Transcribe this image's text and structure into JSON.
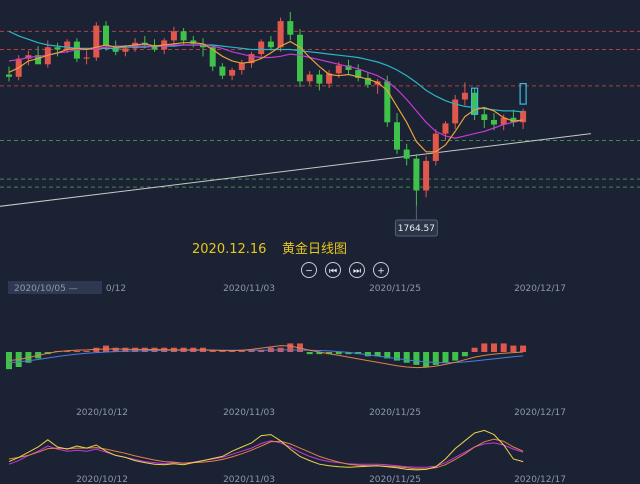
{
  "caption": {
    "date": "2020.12.16",
    "title": "黄金日线图"
  },
  "price_flag": "1764.57",
  "date_box": "2020/10/05 —",
  "colors": {
    "up": "#e0574e",
    "down": "#3ec24a",
    "ma_fast": "#e8a03a",
    "ma_mid": "#c43bd6",
    "ma_slow": "#2bb5c4",
    "macd_line": "#e0824a",
    "signal_line": "#4a7fe0",
    "kdj_k": "#e8d44a",
    "kdj_d": "#e0824a",
    "kdj_j": "#c43bd6",
    "trend": "#c8c8c8",
    "level_red": "#b04040",
    "level_green": "#3e8a4a",
    "outline": "#38bde8"
  },
  "controls": [
    {
      "name": "zoom-out-button",
      "icon": "minus-icon",
      "glyph": "−"
    },
    {
      "name": "step-back-button",
      "icon": "skip-back-icon",
      "glyph": "⏮"
    },
    {
      "name": "step-forward-button",
      "icon": "skip-forward-icon",
      "glyph": "⏭"
    },
    {
      "name": "zoom-in-button",
      "icon": "plus-icon",
      "glyph": "+"
    }
  ],
  "chart_data": [
    {
      "type": "candlestick",
      "x_ticks": [
        "0/12",
        "2020/11/03",
        "2020/11/25",
        "2020/12/17"
      ],
      "ylim": [
        1745,
        1935
      ],
      "levels": [
        {
          "y": 1918,
          "color": "level_red"
        },
        {
          "y": 1902,
          "color": "level_red"
        },
        {
          "y": 1870,
          "color": "level_red"
        },
        {
          "y": 1822,
          "color": "level_green"
        },
        {
          "y": 1788,
          "color": "level_green"
        },
        {
          "y": 1781,
          "color": "level_green"
        }
      ],
      "trendline": [
        [
          -1,
          1764
        ],
        [
          60,
          1828
        ]
      ],
      "low_marker": {
        "index": 42,
        "value": 1764.57
      },
      "candles": [
        [
          1880,
          1887,
          1874,
          1878
        ],
        [
          1878,
          1897,
          1875,
          1894
        ],
        [
          1894,
          1901,
          1888,
          1897
        ],
        [
          1897,
          1905,
          1891,
          1889
        ],
        [
          1889,
          1910,
          1886,
          1904
        ],
        [
          1904,
          1908,
          1896,
          1902
        ],
        [
          1902,
          1911,
          1899,
          1909
        ],
        [
          1909,
          1912,
          1891,
          1894
        ],
        [
          1894,
          1901,
          1889,
          1895
        ],
        [
          1895,
          1926,
          1892,
          1923
        ],
        [
          1923,
          1927,
          1901,
          1905
        ],
        [
          1905,
          1910,
          1897,
          1900
        ],
        [
          1900,
          1906,
          1896,
          1903
        ],
        [
          1903,
          1912,
          1900,
          1908
        ],
        [
          1908,
          1914,
          1903,
          1906
        ],
        [
          1906,
          1911,
          1900,
          1902
        ],
        [
          1902,
          1912,
          1898,
          1910
        ],
        [
          1910,
          1922,
          1907,
          1918
        ],
        [
          1918,
          1921,
          1906,
          1910
        ],
        [
          1910,
          1914,
          1904,
          1907
        ],
        [
          1907,
          1912,
          1896,
          1904
        ],
        [
          1904,
          1906,
          1883,
          1887
        ],
        [
          1887,
          1890,
          1876,
          1879
        ],
        [
          1879,
          1886,
          1875,
          1884
        ],
        [
          1884,
          1893,
          1880,
          1890
        ],
        [
          1890,
          1900,
          1886,
          1898
        ],
        [
          1898,
          1911,
          1894,
          1909
        ],
        [
          1909,
          1914,
          1901,
          1904
        ],
        [
          1904,
          1930,
          1900,
          1927
        ],
        [
          1927,
          1935,
          1910,
          1915
        ],
        [
          1915,
          1920,
          1869,
          1874
        ],
        [
          1874,
          1883,
          1871,
          1880
        ],
        [
          1880,
          1884,
          1866,
          1872
        ],
        [
          1872,
          1884,
          1868,
          1881
        ],
        [
          1881,
          1891,
          1877,
          1888
        ],
        [
          1888,
          1893,
          1880,
          1884
        ],
        [
          1884,
          1889,
          1874,
          1877
        ],
        [
          1877,
          1882,
          1868,
          1871
        ],
        [
          1871,
          1876,
          1863,
          1874
        ],
        [
          1874,
          1879,
          1834,
          1838
        ],
        [
          1838,
          1846,
          1810,
          1814
        ],
        [
          1814,
          1819,
          1800,
          1806
        ],
        [
          1806,
          1810,
          1764,
          1778
        ],
        [
          1778,
          1808,
          1772,
          1804
        ],
        [
          1804,
          1832,
          1800,
          1828
        ],
        [
          1828,
          1839,
          1822,
          1837
        ],
        [
          1837,
          1862,
          1832,
          1858
        ],
        [
          1858,
          1873,
          1853,
          1864
        ],
        [
          1864,
          1868,
          1840,
          1845
        ],
        [
          1845,
          1850,
          1833,
          1840
        ],
        [
          1840,
          1846,
          1831,
          1836
        ],
        [
          1836,
          1845,
          1831,
          1842
        ],
        [
          1842,
          1849,
          1834,
          1838
        ],
        [
          1838,
          1850,
          1832,
          1848
        ]
      ],
      "outline_candles": [
        {
          "index": 48,
          "values": [
            1868,
            1868,
            1845,
            1845
          ]
        },
        {
          "index": 53,
          "values": [
            1854,
            1872,
            1854,
            1872
          ]
        }
      ],
      "ma": {
        "fast": [
          1882,
          1886,
          1892,
          1894,
          1897,
          1899,
          1902,
          1903,
          1902,
          1904,
          1906,
          1904,
          1905,
          1906,
          1907,
          1905,
          1906,
          1907,
          1908,
          1908,
          1907,
          1902,
          1896,
          1892,
          1890,
          1891,
          1894,
          1899,
          1905,
          1909,
          1904,
          1895,
          1887,
          1880,
          1879,
          1880,
          1878,
          1876,
          1873,
          1866,
          1852,
          1838,
          1821,
          1812,
          1812,
          1818,
          1830,
          1843,
          1849,
          1851,
          1848,
          1842,
          1839,
          1840
        ],
        "mid": [
          1892,
          1893,
          1895,
          1896,
          1897,
          1899,
          1900,
          1902,
          1902,
          1903,
          1904,
          1905,
          1905,
          1905,
          1905,
          1905,
          1905,
          1906,
          1906,
          1906,
          1906,
          1905,
          1903,
          1900,
          1898,
          1896,
          1895,
          1895,
          1896,
          1898,
          1897,
          1895,
          1893,
          1891,
          1889,
          1887,
          1885,
          1882,
          1879,
          1874,
          1867,
          1858,
          1848,
          1838,
          1830,
          1826,
          1824,
          1826,
          1828,
          1830,
          1833,
          1836,
          1838,
          1840
        ],
        "slow": [
          1918,
          1914,
          1911,
          1908,
          1906,
          1905,
          1904,
          1903,
          1903,
          1903,
          1903,
          1903,
          1904,
          1904,
          1904,
          1905,
          1905,
          1905,
          1906,
          1906,
          1906,
          1906,
          1905,
          1904,
          1903,
          1902,
          1902,
          1902,
          1902,
          1902,
          1901,
          1900,
          1899,
          1898,
          1897,
          1896,
          1895,
          1893,
          1891,
          1888,
          1884,
          1879,
          1873,
          1866,
          1861,
          1857,
          1854,
          1852,
          1851,
          1850,
          1849,
          1848,
          1848,
          1847
        ]
      }
    },
    {
      "type": "macd",
      "x_ticks": [
        "2020/10/12",
        "2020/11/03",
        "2020/11/25",
        "2020/12/17"
      ],
      "ylim": [
        -14,
        14
      ],
      "histogram": [
        -8,
        -7,
        -5,
        -3,
        -1,
        0.5,
        0.5,
        0.5,
        0.5,
        2,
        3,
        2,
        2,
        2,
        2,
        2,
        2,
        2,
        2,
        2,
        2,
        1,
        1,
        0.5,
        1,
        1,
        1,
        2,
        2,
        4,
        4,
        -1,
        -1,
        -1,
        -1,
        -1,
        -1,
        -2,
        -2,
        -3,
        -4,
        -5,
        -6,
        -7,
        -6,
        -5,
        -4,
        -2,
        2,
        4,
        4,
        4,
        3,
        3
      ],
      "macd_line": [
        -4,
        -3.5,
        -2.6,
        -1.6,
        -0.6,
        0.2,
        0.6,
        0.9,
        1,
        1.2,
        1.4,
        1.4,
        1.3,
        1.2,
        1.2,
        1.1,
        1.1,
        1,
        1,
        1,
        1,
        0.9,
        0.7,
        0.6,
        0.8,
        1.2,
        1.8,
        2.4,
        3,
        2.8,
        1.8,
        0.8,
        0,
        -0.8,
        -1.6,
        -2.4,
        -3.2,
        -4,
        -4.8,
        -5.6,
        -6.4,
        -7,
        -7.3,
        -7.1,
        -6.6,
        -5.8,
        -4.8,
        -3.6,
        -2.4,
        -1.6,
        -1,
        -0.6,
        -0.3,
        0
      ],
      "signal_line": [
        -5,
        -4.6,
        -4.1,
        -3.5,
        -2.8,
        -2.1,
        -1.5,
        -1,
        -0.6,
        -0.3,
        0,
        0.2,
        0.4,
        0.5,
        0.6,
        0.7,
        0.8,
        0.8,
        0.8,
        0.8,
        0.8,
        0.8,
        0.8,
        0.8,
        0.8,
        0.8,
        0.8,
        0.9,
        1,
        1,
        0.9,
        0.8,
        0.7,
        0.5,
        0.2,
        -0.2,
        -0.7,
        -1.3,
        -1.9,
        -2.5,
        -3.1,
        -3.7,
        -4.2,
        -4.6,
        -4.9,
        -5,
        -4.9,
        -4.6,
        -4.2,
        -3.7,
        -3.2,
        -2.7,
        -2.2,
        -1.8
      ]
    },
    {
      "type": "kdj",
      "x_ticks": [
        "2020/10/12",
        "2020/11/03",
        "2020/11/25",
        "2020/12/17"
      ],
      "ylim": [
        0,
        100
      ],
      "K": [
        20,
        28,
        38,
        48,
        62,
        48,
        44,
        50,
        46,
        52,
        40,
        32,
        28,
        22,
        18,
        15,
        14,
        16,
        14,
        18,
        22,
        26,
        30,
        40,
        48,
        56,
        70,
        72,
        60,
        44,
        30,
        22,
        15,
        12,
        10,
        9,
        10,
        11,
        12,
        10,
        8,
        5,
        4,
        5,
        10,
        25,
        45,
        60,
        75,
        80,
        72,
        52,
        25,
        20
      ],
      "D": [
        25,
        28,
        32,
        38,
        45,
        46,
        45,
        46,
        46,
        47,
        44,
        40,
        36,
        31,
        27,
        23,
        20,
        19,
        17,
        18,
        19,
        21,
        24,
        29,
        35,
        42,
        50,
        58,
        59,
        54,
        46,
        38,
        30,
        24,
        19,
        15,
        13,
        12,
        12,
        11,
        10,
        8,
        6,
        6,
        8,
        14,
        24,
        35,
        48,
        58,
        63,
        59,
        48,
        40
      ],
      "J": [
        15,
        22,
        32,
        40,
        50,
        44,
        40,
        42,
        40,
        44,
        38,
        32,
        28,
        24,
        20,
        18,
        16,
        18,
        17,
        19,
        22,
        25,
        28,
        34,
        40,
        46,
        55,
        60,
        56,
        48,
        38,
        30,
        24,
        20,
        18,
        16,
        15,
        15,
        15,
        14,
        12,
        10,
        9,
        9,
        11,
        18,
        28,
        38,
        48,
        54,
        56,
        52,
        44,
        38
      ]
    }
  ]
}
